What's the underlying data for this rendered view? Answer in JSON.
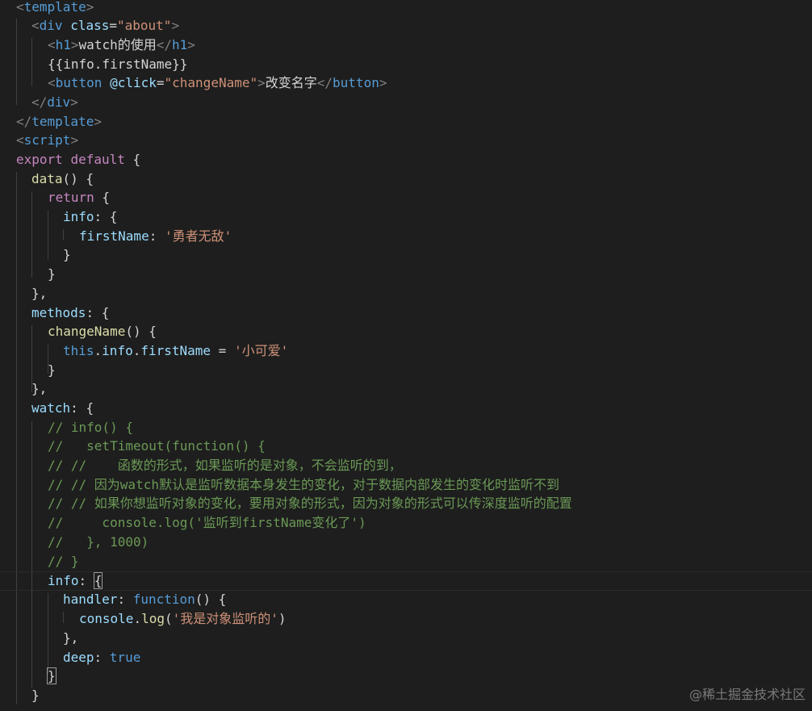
{
  "code": {
    "l1": [
      "<",
      "template",
      ">"
    ],
    "l2": [
      "<",
      "div",
      "class",
      "=",
      "\"about\"",
      ">"
    ],
    "l3": [
      "<",
      "h1",
      ">",
      "watch的使用",
      "</",
      "h1",
      ">"
    ],
    "l4": "{{info.firstName}}",
    "l5": [
      "<",
      "button",
      "@click",
      "=",
      "\"changeName\"",
      ">",
      "改变名字",
      "</",
      "button",
      ">"
    ],
    "l6": [
      "</",
      "div",
      ">"
    ],
    "l7": [
      "</",
      "template",
      ">"
    ],
    "l8": [
      "<",
      "script",
      ">"
    ],
    "l9": [
      "export",
      "default",
      "{"
    ],
    "l10": [
      "data",
      "() {"
    ],
    "l11": [
      "return",
      " {"
    ],
    "l12": [
      "info",
      ": {"
    ],
    "l13": [
      "firstName",
      ": ",
      "'勇者无敌'"
    ],
    "l14": "}",
    "l15": "}",
    "l16": "},",
    "l17": [
      "methods",
      ": {"
    ],
    "l18": [
      "changeName",
      "() {"
    ],
    "l19": [
      "this",
      ".",
      "info",
      ".",
      "firstName",
      " = ",
      "'小可爱'"
    ],
    "l20": "}",
    "l21": "},",
    "l22": [
      "watch",
      ": {"
    ],
    "l23": "// info() {",
    "l24": "//   setTimeout(function() {",
    "l25": "// //    函数的形式，如果监听的是对象，不会监听的到，",
    "l26": "// // 因为watch默认是监听数据本身发生的变化，对于数据内部发生的变化时监听不到",
    "l27": "// // 如果你想监听对象的变化，要用对象的形式，因为对象的形式可以传深度监听的配置",
    "l28": "//     console.log('监听到firstName变化了')",
    "l29": "//   }, 1000)",
    "l30": "// }",
    "l31": [
      "info",
      ": ",
      "{"
    ],
    "l32": [
      "handler",
      ": ",
      "function",
      "() {"
    ],
    "l33": [
      "console",
      ".",
      "log",
      "(",
      "'我是对象监听的'",
      ")"
    ],
    "l34": "},",
    "l35": [
      "deep",
      ": ",
      "true"
    ],
    "l36": "}",
    "l37": "}"
  },
  "watermark": "@稀土掘金技术社区"
}
